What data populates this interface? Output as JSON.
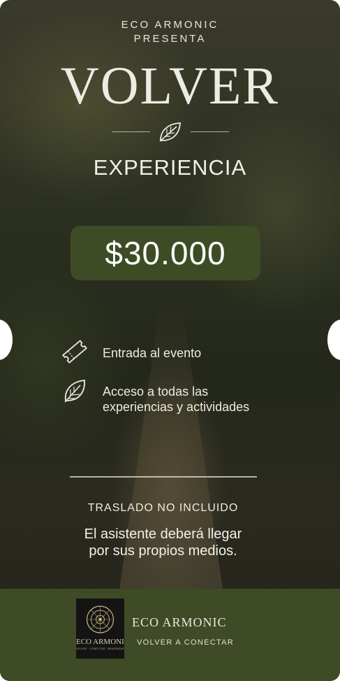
{
  "header": {
    "presenter": "ECO ARMONIC",
    "presents": "PRESENTA",
    "title": "VOLVER",
    "subtitle": "EXPERIENCIA"
  },
  "ticket": {
    "price": "$30.000"
  },
  "features": [
    {
      "icon": "ticket-icon",
      "text": "Entrada al evento"
    },
    {
      "icon": "leaf-icon",
      "line1": "Acceso a todas las",
      "line2": "experiencias y actividades"
    }
  ],
  "transport": {
    "heading": "TRASLADO NO INCLUIDO",
    "line1": "El asistente deberá llegar",
    "line2": "por sus propios medios."
  },
  "footer": {
    "logo_word": "ECO ARMONIC",
    "logo_tagline": "VOLVER · CONECTAR · ARMONIZAR",
    "brand": "ECO ARMONIC",
    "tagline": "VOLVER A CONECTAR"
  },
  "colors": {
    "accent_green": "#3e4c25",
    "footer_green": "#3f4a26",
    "text_light": "#ecebe4"
  }
}
